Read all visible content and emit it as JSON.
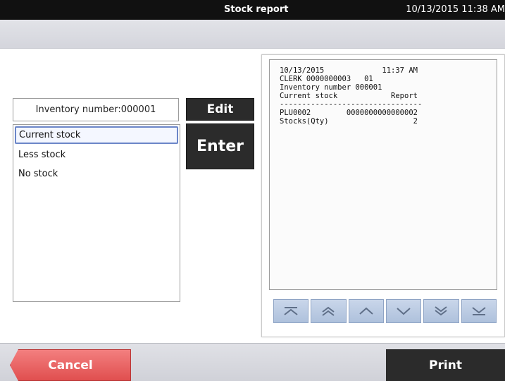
{
  "header": {
    "title": "Stock report",
    "datetime": "10/13/2015 11:38 AM"
  },
  "inventory": {
    "field_value": "Inventory number:000001"
  },
  "report_types": [
    {
      "label": "Current stock",
      "selected": true
    },
    {
      "label": "Less stock",
      "selected": false
    },
    {
      "label": "No stock",
      "selected": false
    }
  ],
  "buttons": {
    "edit": "Edit",
    "enter": "Enter",
    "cancel": "Cancel",
    "print": "Print"
  },
  "receipt": {
    "lines": [
      "10/13/2015             11:37 AM",
      "CLERK 0000000003   01",
      "Inventory number 000001",
      "Current stock            Report",
      "--------------------------------",
      "PLU0002        0000000000000002",
      "Stocks(Qty)                   2"
    ]
  },
  "scroll_buttons": [
    {
      "icon": "scroll-top-icon"
    },
    {
      "icon": "page-up-icon"
    },
    {
      "icon": "line-up-icon"
    },
    {
      "icon": "line-down-icon"
    },
    {
      "icon": "page-down-icon"
    },
    {
      "icon": "scroll-bottom-icon"
    }
  ],
  "colors": {
    "cancel": "#e85a5a",
    "dark_button": "#2b2b2b",
    "scroll_button": "#b8c8e0"
  }
}
